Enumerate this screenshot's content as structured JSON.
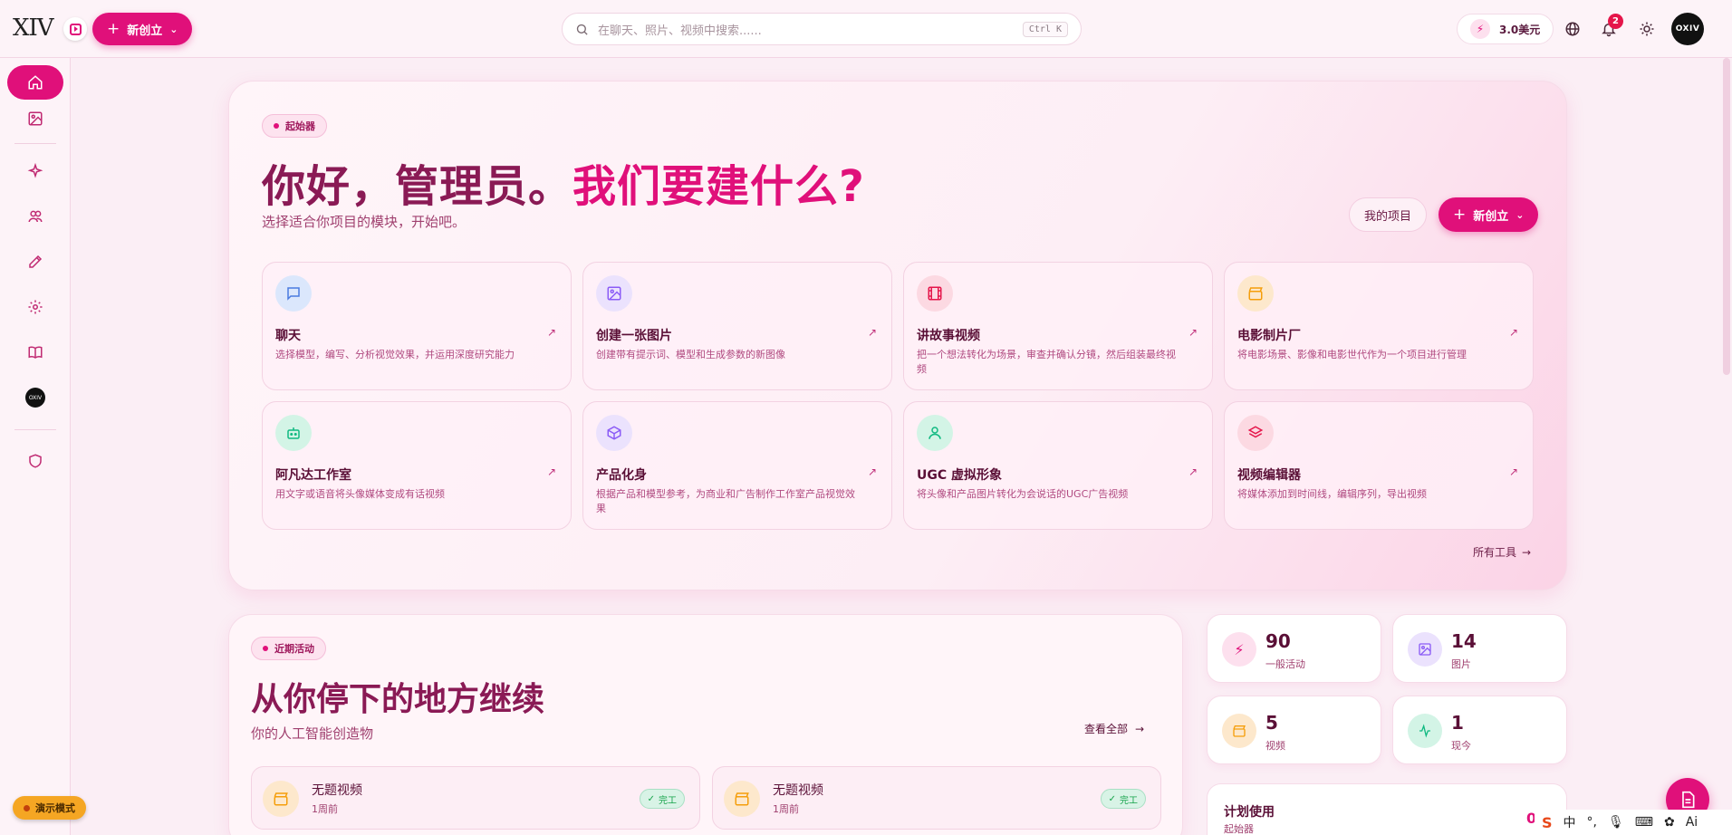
{
  "app": {
    "logo": "XIV"
  },
  "topbar": {
    "new_label": "新创立",
    "search_placeholder": "在聊天、照片、视频中搜索......",
    "search_shortcut": "Ctrl K",
    "credits": "3.0美元",
    "notification_count": "2",
    "avatar_text": "OXIV"
  },
  "sidebar": {
    "items": [
      "home",
      "images",
      "sparkles",
      "users",
      "edit",
      "settings",
      "book",
      "avatar",
      "shield"
    ],
    "demo_mode": "演示模式"
  },
  "hero": {
    "badge": "起始器",
    "title_main": "你好，管理员。",
    "title_accent": "我们要建什么?",
    "subtitle": "选择适合你项目的模块，开始吧。",
    "my_projects": "我的项目",
    "new_label": "新创立",
    "all_tools": "所有工具",
    "tools": [
      {
        "name": "聊天",
        "desc": "选择模型，编写、分析视觉效果，并运用深度研究能力",
        "icon": "chat-icon",
        "color": "#4a7be0",
        "bg": "#dbe7fc"
      },
      {
        "name": "创建一张图片",
        "desc": "创建带有提示词、模型和生成参数的新图像",
        "icon": "image-icon",
        "color": "#8b5cf6",
        "bg": "#ebe2fd"
      },
      {
        "name": "讲故事视频",
        "desc": "把一个想法转化为场景，审查并确认分镜，然后组装最终视频",
        "icon": "film-icon",
        "color": "#e5154a",
        "bg": "#fcd9e2"
      },
      {
        "name": "电影制片厂",
        "desc": "将电影场景、影像和电影世代作为一个项目进行管理",
        "icon": "clapper-icon",
        "color": "#f59e0b",
        "bg": "#fde8cc"
      },
      {
        "name": "阿凡达工作室",
        "desc": "用文字或语音将头像媒体变成有话视频",
        "icon": "robot-icon",
        "color": "#10b981",
        "bg": "#d3f4e6"
      },
      {
        "name": "产品化身",
        "desc": "根据产品和模型参考，为商业和广告制作工作室产品视觉效果",
        "icon": "box-icon",
        "color": "#8b5cf6",
        "bg": "#ebe2fd"
      },
      {
        "name": "UGC 虚拟形象",
        "desc": "将头像和产品图片转化为会说话的UGC广告视频",
        "icon": "person-icon",
        "color": "#10b981",
        "bg": "#d3f4e6"
      },
      {
        "name": "视频编辑器",
        "desc": "将媒体添加到时间线，编辑序列，导出视频",
        "icon": "layers-icon",
        "color": "#e5154a",
        "bg": "#fcd9e2"
      }
    ]
  },
  "recent": {
    "badge": "近期活动",
    "title": "从你停下的地方继续",
    "subtitle": "你的人工智能创造物",
    "view_all": "查看全部",
    "items": [
      {
        "name": "无题视频",
        "time": "1周前",
        "status": "完工"
      },
      {
        "name": "无题视频",
        "time": "1周前",
        "status": "完工"
      }
    ]
  },
  "stats": [
    {
      "value": "90",
      "label": "一般活动",
      "icon": "bolt-icon",
      "color": "#e0107a",
      "bg": "#fde0ee"
    },
    {
      "value": "14",
      "label": "图片",
      "icon": "image-icon",
      "color": "#8b5cf6",
      "bg": "#ebe2fd"
    },
    {
      "value": "5",
      "label": "视频",
      "icon": "clapper-icon",
      "color": "#f59e0b",
      "bg": "#fde8cc"
    },
    {
      "value": "1",
      "label": "现今",
      "icon": "activity-icon",
      "color": "#10b981",
      "bg": "#d3f4e6"
    }
  ],
  "plan": {
    "title": "计划使用",
    "subtitle": "起始器",
    "value": "0"
  },
  "ime": {
    "lang": "中"
  }
}
